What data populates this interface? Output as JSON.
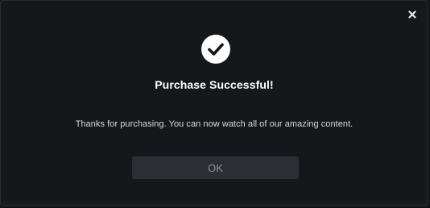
{
  "dialog": {
    "title": "Purchase Successful!",
    "message": "Thanks for purchasing. You can now watch all of our amazing content.",
    "ok_label": "OK",
    "icons": {
      "status": "check-circle-icon",
      "close": "close-icon"
    }
  },
  "colors": {
    "background": "#16171a",
    "title_text": "#ffffff",
    "message_text": "#d9d9dc",
    "button_bg": "#2c2e33",
    "button_text": "#8e9096"
  }
}
